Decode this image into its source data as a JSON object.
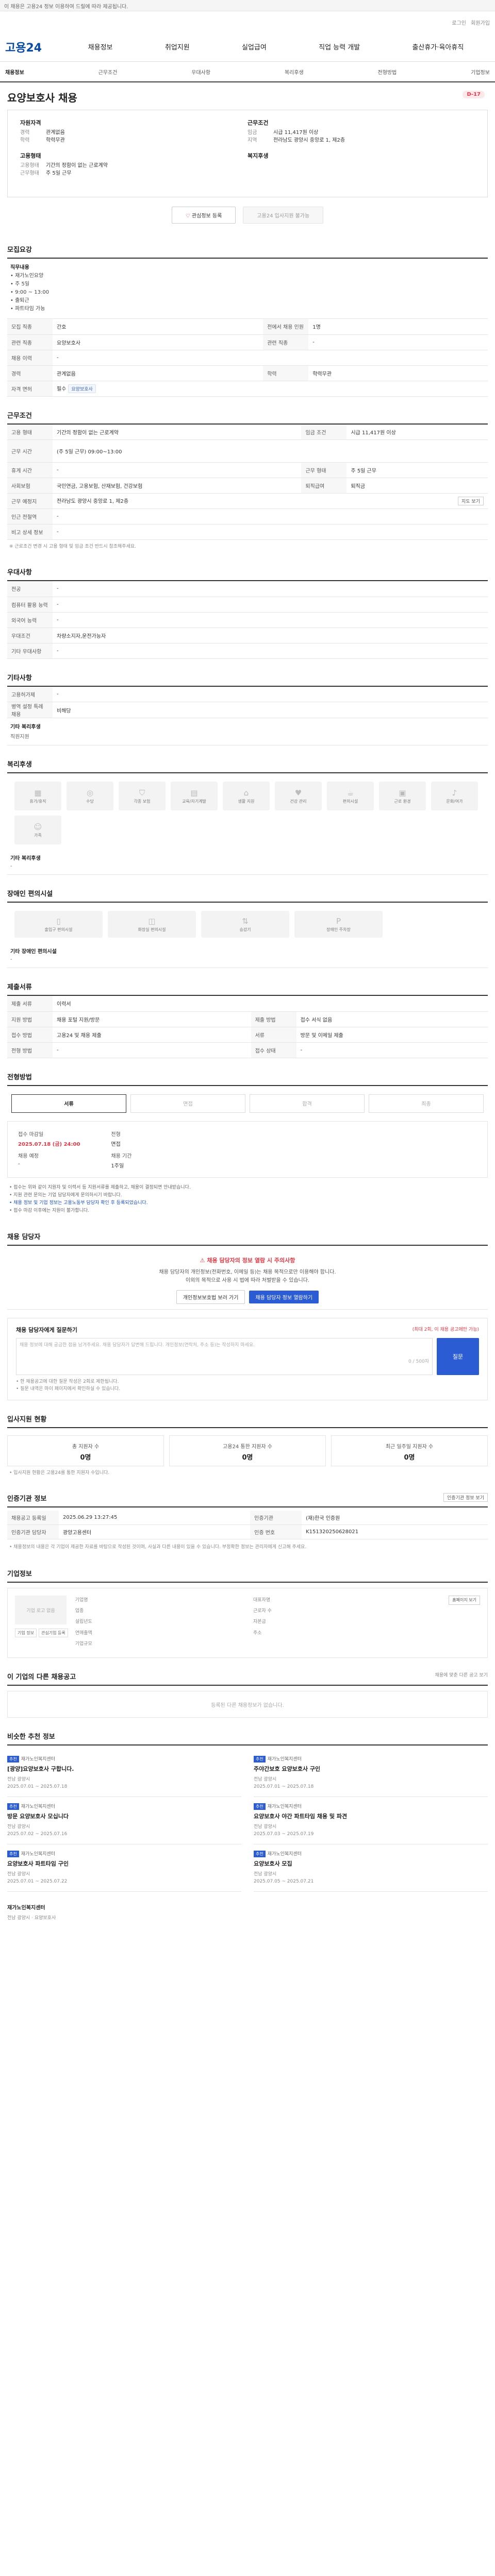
{
  "topbar": {
    "notice": "이 채용은 고용24 정보 이용하여 드릴에 따라 제공됩니다."
  },
  "util": {
    "links": [
      "로그인",
      "회원가입"
    ]
  },
  "header": {
    "logo": "고용24",
    "menu": [
      "채용정보",
      "취업지원",
      "실업급여",
      "직업 능력 개발",
      "출산휴가·육아휴직"
    ]
  },
  "lnb": [
    "채용정보",
    "근무조건",
    "우대사항",
    "복리후생",
    "전형방법",
    "기업정보"
  ],
  "job": {
    "title": "요양보호사 채용",
    "dday": "D-17",
    "left": {
      "g1_title": "자원자격",
      "g1": [
        [
          "경력",
          "관계없음"
        ],
        [
          "학력",
          "학력무관"
        ]
      ],
      "g2_title": "고용형태",
      "g2": [
        [
          "고용형태",
          "기간의 정함이 없는 근로계약"
        ],
        [
          "근무형태",
          "주 5일 근무"
        ]
      ]
    },
    "right": {
      "g1_title": "근무조건",
      "g1": [
        [
          "임금",
          "시급 11,417원 이상"
        ],
        [
          "지역",
          "전라남도 광양시 중앙로 1, 제2층"
        ]
      ],
      "g2_title": "복지후생"
    }
  },
  "buttons": {
    "save": "관심정보 등록",
    "print": "고용24 입사지원 불가능"
  },
  "sec_recruit": {
    "title": "모집요강",
    "intro_title": "직무내용",
    "intro": "• 재가노인요양\n• 주 5일\n• 9:00 ~ 13:00\n• 출퇴근\n• 파트타임 가능",
    "rows": [
      [
        "모집 직종",
        "간호",
        "전에서 채용 인원",
        "1명"
      ],
      [
        "관련 직종",
        "요양보호사",
        "관련 직종",
        "-"
      ],
      [
        "채용 이력",
        "-",
        "",
        ""
      ],
      [
        "경력",
        "관계없음",
        "학력",
        "학력무관"
      ],
      [
        "자격 면허",
        "필수",
        "요양보호사",
        ""
      ]
    ]
  },
  "sec_work": {
    "title": "근무조건",
    "rows": [
      [
        "고용 형태",
        "기간의 정함이 없는 근로계약",
        "임금 조건",
        "시급 11,417원 이상"
      ],
      [
        "근무 시간",
        "(주 5일 근무) 09:00~13:00",
        "",
        ""
      ],
      [
        "휴게 시간",
        "-",
        "근무 형태",
        "주 5일 근무"
      ],
      [
        "사회보험",
        "국민연금, 고용보험, 산재보험, 건강보험",
        "퇴직급여",
        "퇴직금"
      ],
      [
        "근무 예정지",
        "전라남도 광양시 중앙로 1, 제2층",
        "",
        ""
      ],
      [
        "인근 전철역",
        "-",
        "",
        ""
      ],
      [
        "비고 상세 정보",
        "-",
        "",
        ""
      ]
    ],
    "map_btn": "지도 보기",
    "note": "※ 근로조건 변경 시 고용 형태 및 임금 조건 반드시 참조해주세요."
  },
  "sec_pref": {
    "title": "우대사항",
    "rows": [
      [
        "전공",
        "-"
      ],
      [
        "컴퓨터 활용 능력",
        "-"
      ],
      [
        "외국어 능력",
        "-"
      ],
      [
        "우대조건",
        "차량소지자,운전가능자"
      ],
      [
        "기타 우대사항",
        "-"
      ]
    ]
  },
  "sec_etc": {
    "title": "기타사항",
    "rows": [
      [
        "고용허가제",
        "-"
      ],
      [
        "병역 설정 특례 채용",
        "비해당"
      ]
    ],
    "sub_title": "기타 복리후생",
    "sub_val": "직원지원"
  },
  "sec_welfare": {
    "title": "복리후생",
    "items": [
      "휴가/휴직",
      "수당",
      "각종 보험",
      "교육/자기계발",
      "생활 지원",
      "건강 관리",
      "편의시설",
      "근로 환경",
      "문화/여가",
      "가족"
    ],
    "sub_title": "기타 복리후생",
    "sub_val": "-"
  },
  "sec_disabled": {
    "title": "장애인 편의시설",
    "items": [
      "출입구 편의시설",
      "화장실 편의시설",
      "승강기",
      "장애인 주차장"
    ],
    "sub_title": "기타 장애인 편의시설",
    "sub_val": "-"
  },
  "sec_apply": {
    "title": "제출서류",
    "rows": [
      [
        "제출 서류",
        "이력서",
        "",
        ""
      ],
      [
        "지원 방법",
        "채용 포털 지원/방문",
        "제출 방법",
        "접수 서식 없음"
      ],
      [
        "접수 방법",
        "고용24 및 채용 제출",
        "서류",
        "방문 및 이메일 제출"
      ],
      [
        "전형 방법",
        "-",
        "접수 상태",
        "-"
      ]
    ]
  },
  "sec_selection": {
    "title": "전형방법",
    "steps": [
      "서류",
      "면접",
      "합격",
      "최종"
    ],
    "deadline_lab": "접수 마감일",
    "deadline": "2025.07.18 (금) 24:00",
    "open_lab": "채용 예정",
    "open_val": "-",
    "method_lab": "전형",
    "method_val": "면접",
    "type_lab": "채용 기간",
    "type_val": "1주일",
    "bullets": [
      "• 접수는 위와 같이 지원자 및 이력서 등 지원서류를 제출하고, 채용이 결정되면 안내받습니다.",
      "• 지원 관련 문의는 기업 담당자에게 문의하시기 바랍니다.",
      "• 채용 정보 및 기업 정보는 고용노동부 담당자 확인 후 등록되었습니다.",
      "• 접수 마감 이후에는 지원이 불가합니다."
    ]
  },
  "sec_contact": {
    "title": "채용 담당자",
    "warn": "채용 담당자의 정보 열람 시 주의사항",
    "text": "채용 담당자의 개인정보(전화번호, 이메일 등)는 채용 목적으로만 이용해야 합니다.\n이외의 목적으로 사용 시 법에 따라 처벌받을 수 있습니다.",
    "btn1": "개인정보보호법 보러 가기",
    "btn2": "채용 담당자 정보 열람하기"
  },
  "sec_qa": {
    "title": "채용 담당자에게 질문하기",
    "sub": "(최대 2회, 이 채용 공고에만 가능)",
    "placeholder": "채용 정보에 대해 궁금한 점을 남겨주세요. 채용 담당자가 답변해 드립니다. 개인정보(연락처, 주소 등)는 작성하지 마세요.",
    "counter": "0 / 500자",
    "btn": "질문",
    "notes": [
      "• 한 채용공고에 대한 질문 작성은 2회로 제한됩니다.",
      "• 질문 내역은 마이 페이지에서 확인하실 수 있습니다."
    ]
  },
  "sec_stats": {
    "title": "입사지원 현황",
    "items": [
      [
        "총 지원자 수",
        "0명"
      ],
      [
        "고용24 통한 지원자 수",
        "0명"
      ],
      [
        "최근 일주일 지원자 수",
        "0명"
      ]
    ],
    "note": "• 입사지원 현황은 고용24를 통한 지원자 수입니다."
  },
  "sec_info": {
    "title": "인증기관 정보",
    "btn": "인증기관 정보 보기",
    "rows": [
      [
        "채용공고 등록일",
        "2025.06.29 13:27:45",
        "인증기관",
        "(재)한국 인증원"
      ],
      [
        "인증기관 담당자",
        "광양고용센터",
        "인증 번호",
        "K151320250628021"
      ]
    ],
    "note": "• 채용정보의 내용은 각 기업이 제공한 자료를 바탕으로 작성된 것이며, 사실과 다른 내용이 있을 수 있습니다. 부정확한 정보는 관리자에게 신고해 주세요."
  },
  "sec_company": {
    "title": "기업정보",
    "logo_alt": "기업 로고 없음",
    "btns": [
      "기업 정보",
      "관심기업 등록"
    ],
    "home_btn": "홈페이지 보기",
    "grid": [
      [
        "기업명",
        "",
        "대표자명",
        ""
      ],
      [
        "업종",
        "",
        "근로자 수",
        ""
      ],
      [
        "설립년도",
        "",
        "자본금",
        ""
      ],
      [
        "연매출액",
        "",
        "주소",
        ""
      ],
      [
        "기업규모",
        "",
        "",
        ""
      ]
    ]
  },
  "sec_other": {
    "title": "이 기업의 다른 채용공고",
    "empty": "등록된 다른 채용정보가 없습니다.",
    "more": "채용에 맞춘 다른 공고 보기"
  },
  "sec_rec": {
    "title": "비슷한 추천 정보",
    "items": [
      {
        "badge": "추천",
        "comp": "재가노인복지센터",
        "title": "[광양]요양보호사 구합니다.",
        "meta": "전남 광양시\n2025.07.01 ~ 2025.07.18"
      },
      {
        "badge": "추천",
        "comp": "재가노인복지센터",
        "title": "주야간보호 요양보호사 구인",
        "meta": "전남 광양시\n2025.07.01 ~ 2025.07.18"
      },
      {
        "badge": "추천",
        "comp": "재가노인복지센터",
        "title": "방문 요양보호사 모십니다",
        "meta": "전남 광양시\n2025.07.02 ~ 2025.07.16"
      },
      {
        "badge": "추천",
        "comp": "재가노인복지센터",
        "title": "요양보호사 야간 파트타임 채용 및 파견",
        "meta": "전남 광양시\n2025.07.03 ~ 2025.07.19"
      },
      {
        "badge": "추천",
        "comp": "재가노인복지센터",
        "title": "요양보호사 파트타임 구인",
        "meta": "전남 광양시\n2025.07.01 ~ 2025.07.22"
      },
      {
        "badge": "추천",
        "comp": "재가노인복지센터",
        "title": "요양보호사 모집",
        "meta": "전남 광양시\n2025.07.05 ~ 2025.07.21"
      }
    ],
    "last_title": "재가노인복지센터",
    "last_meta": "전남 광양시 · 요양보호사"
  }
}
